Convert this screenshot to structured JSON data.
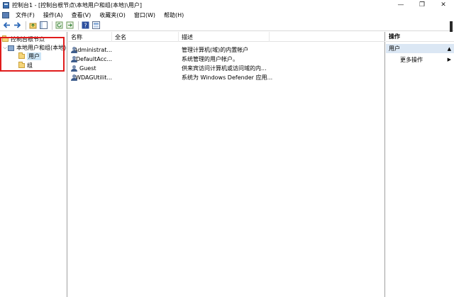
{
  "window": {
    "title": "控制台1 - [控制台根节点\\本地用户和组(本地)\\用户]",
    "controls": {
      "minimize": "—",
      "restore": "❐",
      "close": "✕"
    }
  },
  "menu": {
    "items": [
      "文件(F)",
      "操作(A)",
      "查看(V)",
      "收藏夹(O)",
      "窗口(W)",
      "帮助(H)"
    ]
  },
  "toolbar": {
    "icons": [
      "back-arrow-icon",
      "forward-arrow-icon",
      "up-folder-icon",
      "show-tree-icon",
      "refresh-icon",
      "export-icon",
      "help-icon",
      "properties-icon"
    ]
  },
  "tree": {
    "root": "控制台根节点",
    "snapin": "本地用户和组(本地)",
    "children": [
      "用户",
      "组"
    ],
    "selected": "用户"
  },
  "list": {
    "columns": [
      "名称",
      "全名",
      "描述"
    ],
    "rows": [
      {
        "name": "Administrat...",
        "fullname": "",
        "description": "管理计算机(域)的内置帐户"
      },
      {
        "name": "DefaultAcc...",
        "fullname": "",
        "description": "系统管理的用户帐户。"
      },
      {
        "name": "Guest",
        "fullname": "",
        "description": "供来宾访问计算机或访问域的内..."
      },
      {
        "name": "WDAGUtilit...",
        "fullname": "",
        "description": "系统为 Windows Defender 应用..."
      }
    ]
  },
  "actions": {
    "title": "操作",
    "section": "用户",
    "items": [
      "更多操作"
    ]
  },
  "colors": {
    "highlight_box": "#e01c1c",
    "selection": "#cde6f7",
    "actions_section": "#dbe7f4"
  }
}
